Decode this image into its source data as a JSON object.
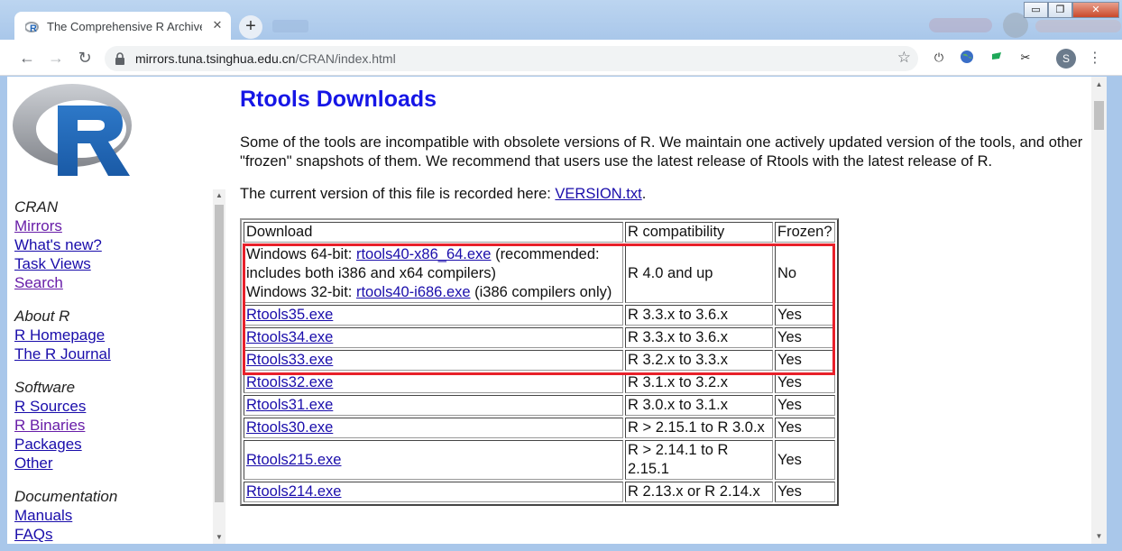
{
  "browser": {
    "tab_title": "The Comprehensive R Archive Network",
    "tab_close": "✕",
    "new_tab": "+",
    "url_host": "mirrors.tuna.tsinghua.edu.cn",
    "url_path": "/CRAN/index.html",
    "profile_initial": "S",
    "window_buttons": {
      "minimize": "▭",
      "restore": "❐",
      "close": "✕"
    }
  },
  "sidebar": {
    "sections": [
      {
        "heading": "CRAN",
        "links": [
          {
            "label": "Mirrors",
            "visited": true
          },
          {
            "label": "What's new?",
            "visited": false
          },
          {
            "label": "Task Views",
            "visited": false
          },
          {
            "label": "Search",
            "visited": true
          }
        ]
      },
      {
        "heading": "About R",
        "links": [
          {
            "label": "R Homepage",
            "visited": false
          },
          {
            "label": "The R Journal",
            "visited": false
          }
        ]
      },
      {
        "heading": "Software",
        "links": [
          {
            "label": "R Sources",
            "visited": false
          },
          {
            "label": "R Binaries",
            "visited": true
          },
          {
            "label": "Packages",
            "visited": false
          },
          {
            "label": "Other",
            "visited": false
          }
        ]
      },
      {
        "heading": "Documentation",
        "links": [
          {
            "label": "Manuals",
            "visited": false
          },
          {
            "label": "FAQs",
            "visited": false
          }
        ]
      }
    ]
  },
  "main": {
    "title": "Rtools Downloads",
    "intro": "Some of the tools are incompatible with obsolete versions of R. We maintain one actively updated version of the tools, and other \"frozen\" snapshots of them. We recommend that users use the latest release of Rtools with the latest release of R.",
    "current_prefix": "The current version of this file is recorded here: ",
    "current_link": "VERSION.txt",
    "current_suffix": ".",
    "table": {
      "headers": [
        "Download",
        "R compatibility",
        "Frozen?"
      ],
      "first_row": {
        "win64_prefix": "Windows 64-bit: ",
        "win64_link": "rtools40-x86_64.exe",
        "win64_suffix": " (recommended: includes both i386 and x64 compilers)",
        "win32_prefix": "Windows 32-bit: ",
        "win32_link": "rtools40-i686.exe",
        "win32_suffix": " (i386 compilers only)",
        "compat": "R 4.0 and up",
        "frozen": "No"
      },
      "rows": [
        {
          "file": "Rtools35.exe",
          "compat": "R 3.3.x to 3.6.x",
          "frozen": "Yes"
        },
        {
          "file": "Rtools34.exe",
          "compat": "R 3.3.x to 3.6.x",
          "frozen": "Yes"
        },
        {
          "file": "Rtools33.exe",
          "compat": "R 3.2.x to 3.3.x",
          "frozen": "Yes"
        },
        {
          "file": "Rtools32.exe",
          "compat": "R 3.1.x to 3.2.x",
          "frozen": "Yes"
        },
        {
          "file": "Rtools31.exe",
          "compat": "R 3.0.x to 3.1.x",
          "frozen": "Yes"
        },
        {
          "file": "Rtools30.exe",
          "compat": "R > 2.15.1 to R 3.0.x",
          "frozen": "Yes"
        },
        {
          "file": "Rtools215.exe",
          "compat": "R > 2.14.1 to R 2.15.1",
          "frozen": "Yes"
        },
        {
          "file": "Rtools214.exe",
          "compat": "R 2.13.x or R 2.14.x",
          "frozen": "Yes"
        }
      ]
    }
  },
  "colors": {
    "heading_blue": "#1616e6",
    "link": "#1a0dab",
    "visited": "#681da8",
    "highlight": "#e8202a"
  }
}
